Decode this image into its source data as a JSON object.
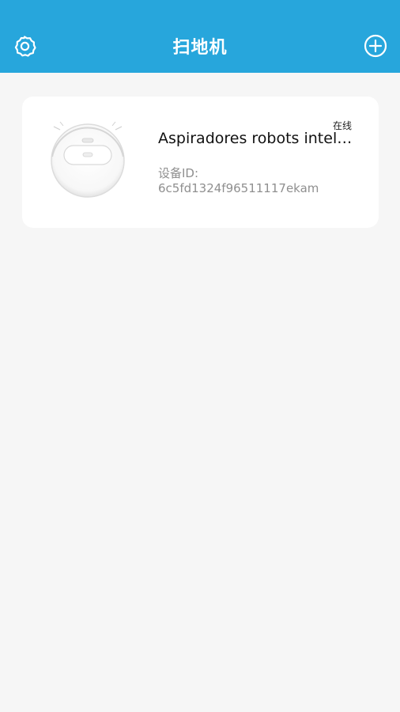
{
  "header": {
    "title": "扫地机",
    "settings_icon": "gear-icon",
    "add_icon": "plus-circle-icon",
    "background_color": "#27a6dc"
  },
  "device": {
    "status": "在线",
    "name": "Aspiradores robots inteli...",
    "id_label": "设备ID:",
    "id_value": "6c5fd1324f96511117ekam",
    "image_icon": "robot-vacuum-image"
  }
}
